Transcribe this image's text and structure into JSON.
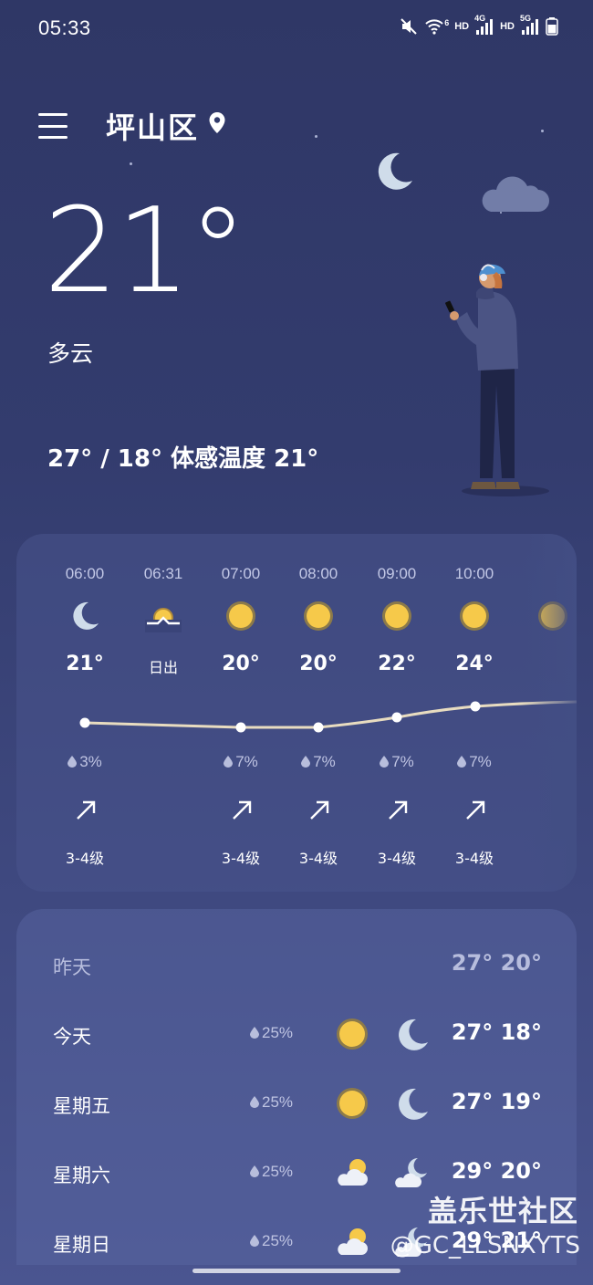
{
  "status_bar": {
    "time": "05:33",
    "wifi_badge": "6",
    "hd1": "HD",
    "net1": "4G",
    "hd2": "HD",
    "net2": "5G"
  },
  "header": {
    "location": "坪山区"
  },
  "current": {
    "temperature": "21°",
    "condition": "多云",
    "range_feels": "27° / 18° 体感温度 21°"
  },
  "hourly": [
    {
      "time": "06:00",
      "icon": "moon-icon",
      "temp": "21°",
      "temp_value": 21,
      "rain": "3%",
      "wind": "3-4级"
    },
    {
      "time": "06:31",
      "icon": "sunrise-icon",
      "temp": "日出",
      "temp_value": null,
      "rain": "",
      "wind": ""
    },
    {
      "time": "07:00",
      "icon": "sun-icon",
      "temp": "20°",
      "temp_value": 20,
      "rain": "7%",
      "wind": "3-4级"
    },
    {
      "time": "08:00",
      "icon": "sun-icon",
      "temp": "20°",
      "temp_value": 20,
      "rain": "7%",
      "wind": "3-4级"
    },
    {
      "time": "09:00",
      "icon": "sun-icon",
      "temp": "22°",
      "temp_value": 22,
      "rain": "7%",
      "wind": "3-4级"
    },
    {
      "time": "10:00",
      "icon": "sun-icon",
      "temp": "24°",
      "temp_value": 24,
      "rain": "7%",
      "wind": "3-4级"
    }
  ],
  "daily": [
    {
      "name": "昨天",
      "rain": "",
      "day_icon": "",
      "night_icon": "",
      "temps": "27° 20°",
      "yesterday": true
    },
    {
      "name": "今天",
      "rain": "25%",
      "day_icon": "sun-icon",
      "night_icon": "moon-icon",
      "temps": "27° 18°"
    },
    {
      "name": "星期五",
      "rain": "25%",
      "day_icon": "sun-icon",
      "night_icon": "moon-icon",
      "temps": "27° 19°"
    },
    {
      "name": "星期六",
      "rain": "25%",
      "day_icon": "partly-cloudy-day-icon",
      "night_icon": "partly-cloudy-night-icon",
      "temps": "29° 20°"
    },
    {
      "name": "星期日",
      "rain": "25%",
      "day_icon": "partly-cloudy-day-icon",
      "night_icon": "partly-cloudy-night-icon",
      "temps": "29° 21°"
    }
  ],
  "watermark": {
    "line1": "盖乐世社区",
    "line2": "@GC_LLSNXYTS"
  },
  "colors": {
    "background_top": "#2f3766",
    "background_bottom": "#4a5590",
    "sun": "#f6c94a",
    "moon": "#cfdcea",
    "temp_curve": "#e9d9a8"
  }
}
